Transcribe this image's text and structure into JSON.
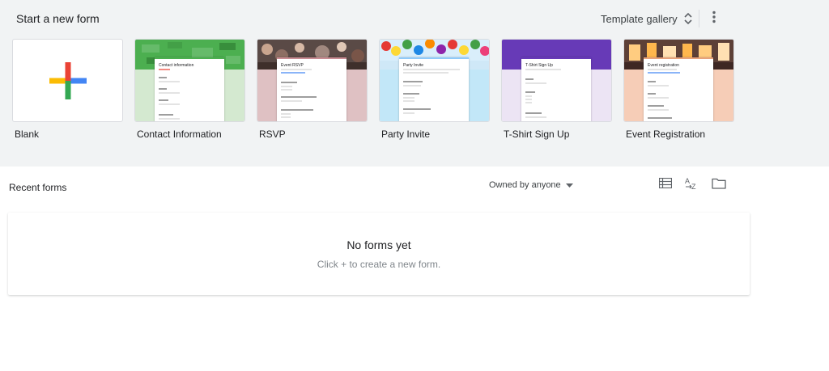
{
  "header": {
    "title": "Start a new form",
    "template_gallery_label": "Template gallery",
    "more_icon": "more-vert-icon",
    "unfold_icon": "unfold-more-icon"
  },
  "templates": [
    {
      "label": "Blank",
      "theme": "#ffffff"
    },
    {
      "label": "Contact Information",
      "theme": "#4caf50",
      "sheet_title": "Contact information"
    },
    {
      "label": "RSVP",
      "theme": "#dbb6b9",
      "sheet_title": "Event RSVP"
    },
    {
      "label": "Party Invite",
      "theme": "#b3e5fc",
      "sheet_title": "Party Invite"
    },
    {
      "label": "T-Shirt Sign Up",
      "theme": "#673ab7",
      "sheet_title": "T-Shirt Sign Up"
    },
    {
      "label": "Event Registration",
      "theme": "#f6c9b3",
      "sheet_title": "Event registration"
    }
  ],
  "recent": {
    "title": "Recent forms",
    "owner_filter": "Owned by anyone",
    "list_view_icon": "list-view-icon",
    "sort_icon": "sort-az-icon",
    "folder_icon": "folder-icon",
    "empty_title": "No forms yet",
    "empty_subtitle": "Click + to create a new form."
  },
  "colors": {
    "plus_red": "#ea4335",
    "plus_blue": "#4285f4",
    "plus_green": "#34a853",
    "plus_yellow": "#fbbc04"
  }
}
